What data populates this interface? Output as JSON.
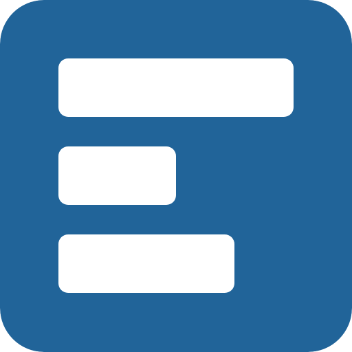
{
  "icon": {
    "name": "list-lines-app-icon",
    "background_color": "#216499",
    "bar_color": "#ffffff",
    "bars": [
      {
        "name": "top-bar"
      },
      {
        "name": "middle-bar"
      },
      {
        "name": "bottom-bar"
      }
    ]
  }
}
